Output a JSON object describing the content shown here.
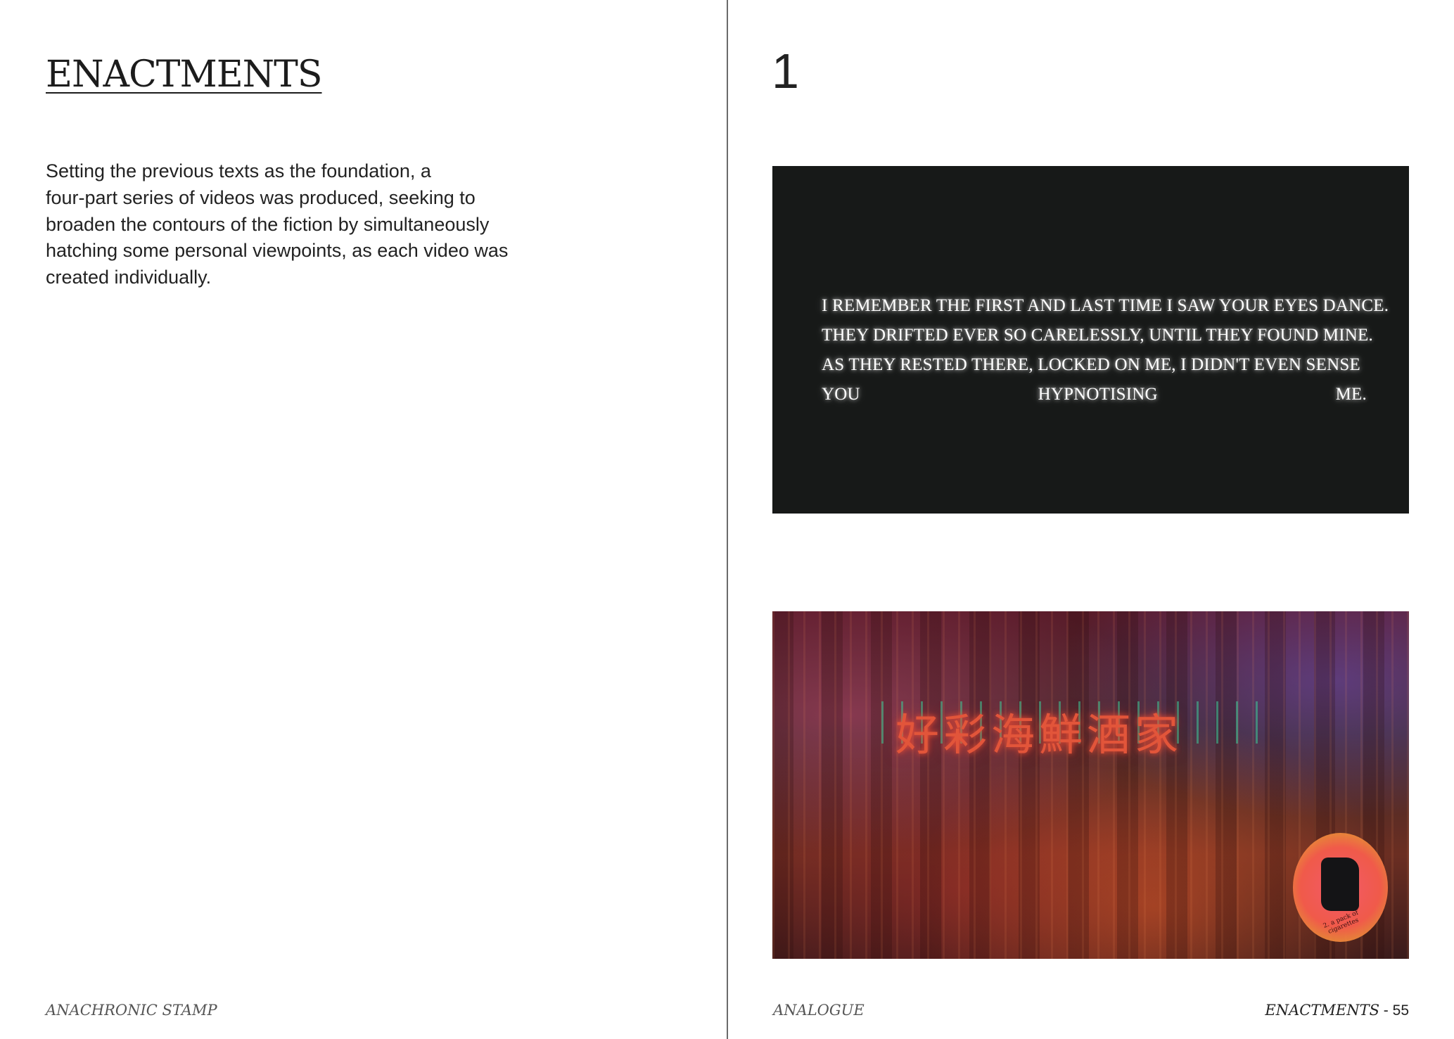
{
  "left_page": {
    "title": "ENACTMENTS",
    "body_lines": [
      "Setting the previous texts as the foundation, a",
      "four-part series of videos was produced, seeking to",
      "broaden the contours of the fiction by simultaneously",
      "hatching some personal viewpoints, as each video was",
      "created individually."
    ],
    "footer": "ANACHRONIC STAMP"
  },
  "right_page": {
    "chapter_number": "1",
    "video_still_1": {
      "lines": [
        "I REMEMBER THE FIRST AND LAST TIME I SAW YOUR EYES DANCE.",
        "THEY DRIFTED EVER SO CARELESSLY, UNTIL THEY FOUND MINE.",
        "AS THEY RESTED THERE, LOCKED ON ME, I DIDN'T EVEN SENSE"
      ],
      "last_line_words": [
        "YOU",
        "HYPNOTISING",
        "ME."
      ]
    },
    "video_still_2": {
      "neon_sign": "好彩海鮮酒家",
      "badge_caption": "2. a pack of cigarettes"
    },
    "footer_left": "ANALOGUE",
    "footer_right_title": "ENACTMENTS",
    "footer_right_sep": " - ",
    "footer_right_page": "55"
  }
}
